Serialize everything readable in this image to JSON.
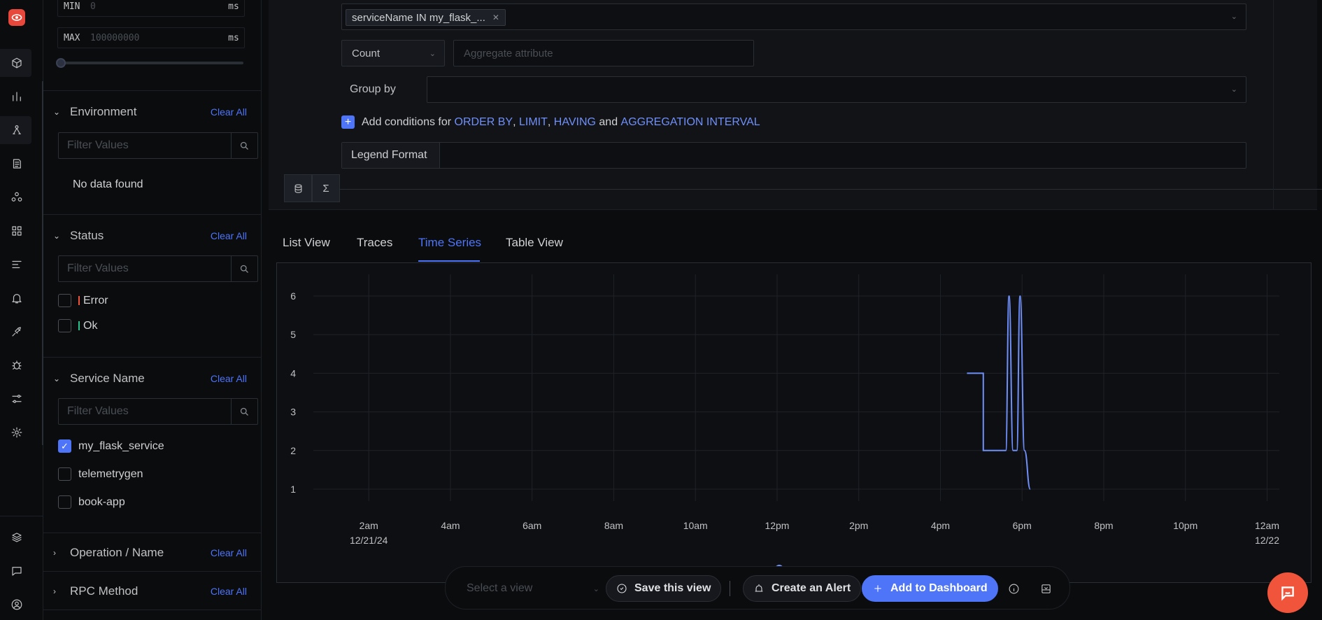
{
  "rail": {
    "items": [
      "logo",
      "services",
      "dashboards",
      "traces",
      "logs",
      "service-map",
      "apps",
      "pipelines",
      "alerts",
      "integrations",
      "exceptions",
      "workflows",
      "settings"
    ],
    "bottom": [
      "layers",
      "messages",
      "account"
    ]
  },
  "duration": {
    "min_label": "MIN",
    "min_placeholder": "0",
    "min_unit": "ms",
    "max_label": "MAX",
    "max_placeholder": "100000000",
    "max_unit": "ms"
  },
  "filters": {
    "clear_label": "Clear All",
    "search_placeholder": "Filter Values",
    "environment": {
      "title": "Environment",
      "empty": "No data found"
    },
    "status": {
      "title": "Status",
      "options": [
        {
          "label": "Error",
          "color": "#f0553b"
        },
        {
          "label": "Ok",
          "color": "#27c48b"
        }
      ]
    },
    "service_name": {
      "title": "Service Name",
      "options": [
        {
          "label": "my_flask_service",
          "checked": true
        },
        {
          "label": "telemetrygen",
          "checked": false
        },
        {
          "label": "book-app",
          "checked": false
        }
      ]
    },
    "operation": {
      "title": "Operation / Name"
    },
    "rpc": {
      "title": "RPC Method"
    }
  },
  "query": {
    "where_chip": "serviceName IN my_flask_...",
    "aggregate_op": "Count",
    "aggregate_placeholder": "Aggregate attribute",
    "group_by_label": "Group by",
    "add_conditions": {
      "prefix": "Add conditions for",
      "order_by": "ORDER BY",
      "limit": "LIMIT",
      "having": "HAVING",
      "and": "and",
      "interval": "AGGREGATION INTERVAL"
    },
    "legend_label": "Legend Format",
    "sigma": "Σ"
  },
  "tabs": [
    "List View",
    "Traces",
    "Time Series",
    "Table View"
  ],
  "active_tab": "Time Series",
  "chart_data": {
    "type": "line",
    "y_ticks": [
      1,
      2,
      3,
      4,
      5,
      6
    ],
    "x_ticks": [
      "2am",
      "4am",
      "6am",
      "8am",
      "10am",
      "12pm",
      "2pm",
      "4pm",
      "6pm",
      "8pm",
      "10pm",
      "12am"
    ],
    "x_tick_dates": {
      "2am": "12/21/24",
      "12am": "12/22"
    },
    "x_hours": [
      2,
      4,
      6,
      8,
      10,
      12,
      14,
      16,
      18,
      20,
      22,
      24
    ],
    "ylim": [
      1,
      6
    ],
    "grid": true,
    "series_color": "#6f8ff9",
    "series": [
      {
        "hours": [
          16.65,
          17.05,
          17.05,
          17.6,
          17.68,
          17.78,
          17.87,
          17.95,
          18.06,
          18.2
        ],
        "values": [
          4,
          4,
          2,
          2,
          6,
          2,
          2,
          6,
          2,
          1
        ]
      }
    ]
  },
  "toolbar": {
    "select_placeholder": "Select a view",
    "save_view": "Save this view",
    "create_alert": "Create an Alert",
    "add_dashboard": "Add to Dashboard"
  }
}
